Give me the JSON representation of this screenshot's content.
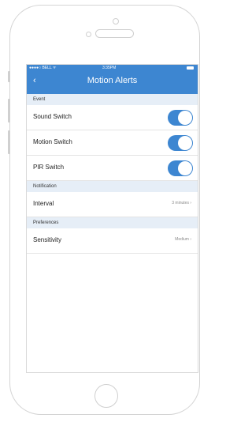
{
  "status": {
    "carrier": "●●●●○ BELL ᯤ",
    "time": "3:35PM"
  },
  "header": {
    "back": "‹",
    "title": "Motion Alerts"
  },
  "sections": {
    "event": "Event",
    "notification": "Notification",
    "preferences": "Preferences"
  },
  "rows": {
    "sound": {
      "label": "Sound Switch",
      "on": true
    },
    "motion": {
      "label": "Motion Switch",
      "on": true
    },
    "pir": {
      "label": "PIR Switch",
      "on": true
    },
    "interval": {
      "label": "Interval",
      "value": "3 minutes ›"
    },
    "sensitivity": {
      "label": "Sensitivity",
      "value": "Medium ›"
    }
  },
  "colors": {
    "accent": "#3d86d1",
    "section_bg": "#e6eef7"
  },
  "icons": [
    "back-chevron-icon",
    "battery-icon",
    "signal-icon",
    "camera-icon",
    "speaker-icon",
    "home-button-icon"
  ]
}
